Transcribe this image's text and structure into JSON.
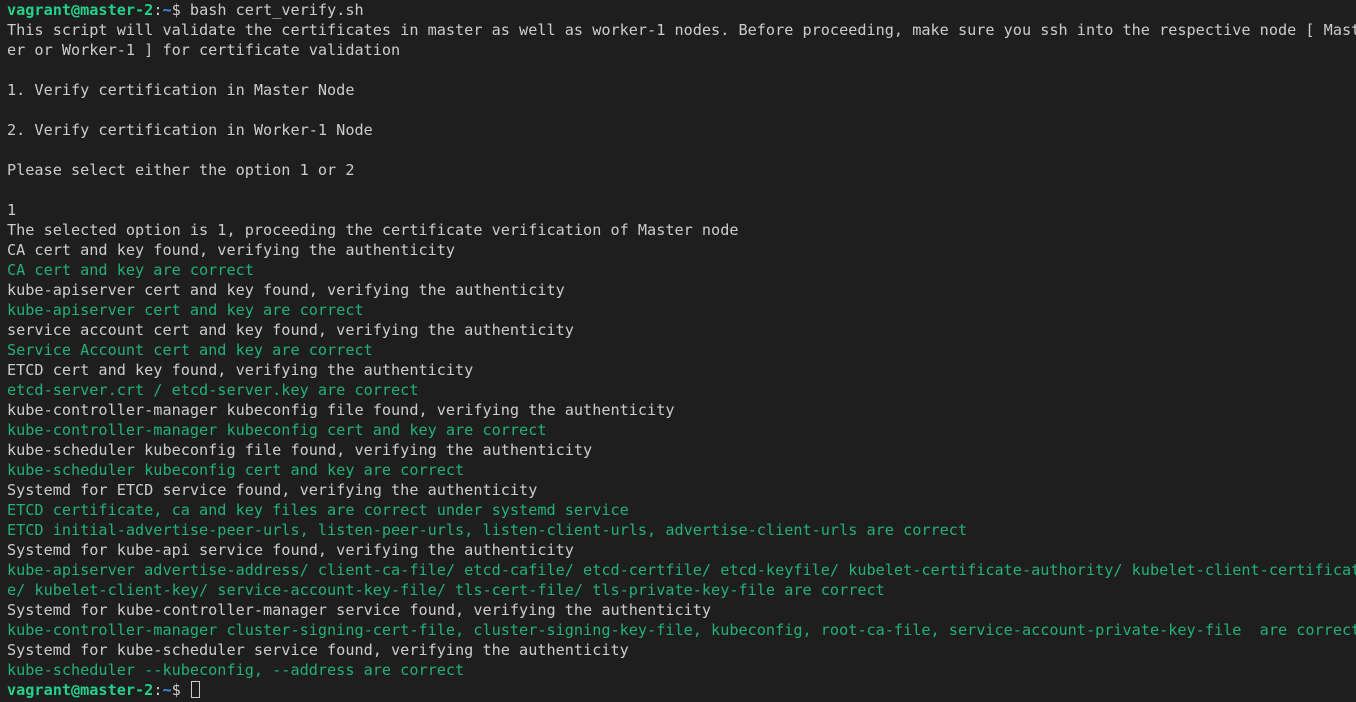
{
  "terminal": {
    "colors": {
      "background": "#1e1e1e",
      "foreground": "#cccccc",
      "success": "#23d18b",
      "prompt_user": "#23d18b",
      "prompt_path": "#3b8eea"
    },
    "prompt": {
      "user_host": "vagrant@master-2",
      "separator": ":",
      "path": "~",
      "symbol": "$ "
    },
    "command": "bash cert_verify.sh",
    "lines": [
      {
        "type": "out",
        "text": "This script will validate the certificates in master as well as worker-1 nodes. Before proceeding, make sure you ssh into the respective node [ Mast"
      },
      {
        "type": "out",
        "text": "er or Worker-1 ] for certificate validation"
      },
      {
        "type": "out",
        "text": ""
      },
      {
        "type": "out",
        "text": "1. Verify certification in Master Node"
      },
      {
        "type": "out",
        "text": ""
      },
      {
        "type": "out",
        "text": "2. Verify certification in Worker-1 Node"
      },
      {
        "type": "out",
        "text": ""
      },
      {
        "type": "out",
        "text": "Please select either the option 1 or 2"
      },
      {
        "type": "out",
        "text": ""
      },
      {
        "type": "out",
        "text": "1"
      },
      {
        "type": "out",
        "text": "The selected option is 1, proceeding the certificate verification of Master node"
      },
      {
        "type": "out",
        "text": "CA cert and key found, verifying the authenticity"
      },
      {
        "type": "ok",
        "text": "CA cert and key are correct"
      },
      {
        "type": "out",
        "text": "kube-apiserver cert and key found, verifying the authenticity"
      },
      {
        "type": "ok",
        "text": "kube-apiserver cert and key are correct"
      },
      {
        "type": "out",
        "text": "service account cert and key found, verifying the authenticity"
      },
      {
        "type": "ok",
        "text": "Service Account cert and key are correct"
      },
      {
        "type": "out",
        "text": "ETCD cert and key found, verifying the authenticity"
      },
      {
        "type": "ok",
        "text": "etcd-server.crt / etcd-server.key are correct"
      },
      {
        "type": "out",
        "text": "kube-controller-manager kubeconfig file found, verifying the authenticity"
      },
      {
        "type": "ok",
        "text": "kube-controller-manager kubeconfig cert and key are correct"
      },
      {
        "type": "out",
        "text": "kube-scheduler kubeconfig file found, verifying the authenticity"
      },
      {
        "type": "ok",
        "text": "kube-scheduler kubeconfig cert and key are correct"
      },
      {
        "type": "out",
        "text": "Systemd for ETCD service found, verifying the authenticity"
      },
      {
        "type": "ok",
        "text": "ETCD certificate, ca and key files are correct under systemd service"
      },
      {
        "type": "ok",
        "text": "ETCD initial-advertise-peer-urls, listen-peer-urls, listen-client-urls, advertise-client-urls are correct"
      },
      {
        "type": "out",
        "text": "Systemd for kube-api service found, verifying the authenticity"
      },
      {
        "type": "ok",
        "text": "kube-apiserver advertise-address/ client-ca-file/ etcd-cafile/ etcd-certfile/ etcd-keyfile/ kubelet-certificate-authority/ kubelet-client-certificat"
      },
      {
        "type": "ok",
        "text": "e/ kubelet-client-key/ service-account-key-file/ tls-cert-file/ tls-private-key-file are correct"
      },
      {
        "type": "out",
        "text": "Systemd for kube-controller-manager service found, verifying the authenticity"
      },
      {
        "type": "ok",
        "text": "kube-controller-manager cluster-signing-cert-file, cluster-signing-key-file, kubeconfig, root-ca-file, service-account-private-key-file  are correct"
      },
      {
        "type": "out",
        "text": "Systemd for kube-scheduler service found, verifying the authenticity"
      },
      {
        "type": "ok",
        "text": "kube-scheduler --kubeconfig, --address are correct"
      }
    ]
  }
}
